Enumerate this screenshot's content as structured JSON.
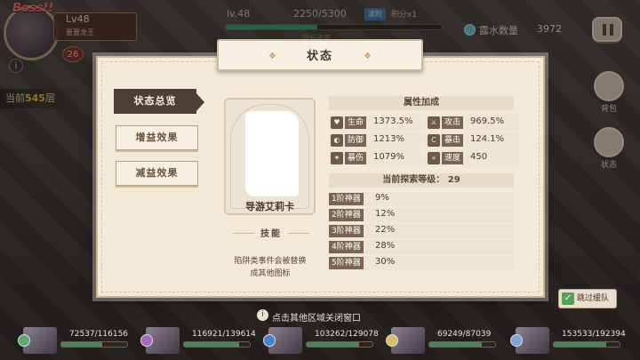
{
  "boss": {
    "tag": "Boss!!",
    "level": "Lv48",
    "name": "噩噩龙王",
    "count": "26"
  },
  "floor": {
    "prefix": "当前",
    "num": "545",
    "suffix": "层"
  },
  "hud": {
    "level": "lv.48",
    "xp": "2250/5300",
    "mode_badge": "波险",
    "mode_text": "积分x1",
    "progress_caption": "开拓进度",
    "xp_fraction": 0.4245,
    "dew_label": "露水数量",
    "dew_value": "3972"
  },
  "side": {
    "bag": "背包",
    "status": "状态"
  },
  "panel": {
    "title": "状态"
  },
  "tabs": [
    {
      "label": "状态总览",
      "active": true
    },
    {
      "label": "增益效果",
      "active": false
    },
    {
      "label": "减益效果",
      "active": false
    }
  ],
  "card": {
    "name": "导游艾莉卡",
    "skill_label": "技能",
    "skill_desc_1": "陷阱类事件会被替换",
    "skill_desc_2": "成其他图标"
  },
  "attributes": {
    "header": "属性加成",
    "items": [
      {
        "icon": "heart-icon",
        "symbol": "♥",
        "name": "生命",
        "value": "1373.5%"
      },
      {
        "icon": "sword-icon",
        "symbol": "⚔",
        "name": "攻击",
        "value": "969.5%"
      },
      {
        "icon": "shield-icon",
        "symbol": "◐",
        "name": "防御",
        "value": "1213%"
      },
      {
        "icon": "crit-icon",
        "symbol": "C",
        "name": "暴击",
        "value": "124.1%"
      },
      {
        "icon": "burst-icon",
        "symbol": "✦",
        "name": "暴伤",
        "value": "1079%"
      },
      {
        "icon": "speed-icon",
        "symbol": "»",
        "name": "速度",
        "value": "450"
      }
    ]
  },
  "gear": {
    "header_label": "当前探索等级：",
    "header_value": "29",
    "rows": [
      {
        "name": "1阶神器",
        "value": "9%"
      },
      {
        "name": "2阶神器",
        "value": "12%"
      },
      {
        "name": "3阶神器",
        "value": "22%"
      },
      {
        "name": "4阶神器",
        "value": "28%"
      },
      {
        "name": "5阶神器",
        "value": "30%"
      }
    ]
  },
  "hint": {
    "text": "点击其他区域关闭窗口"
  },
  "skip": {
    "label": "跳过缓队"
  },
  "party": [
    {
      "hp": "72537/116156",
      "color": "#56b06a",
      "fraction": 0.6245
    },
    {
      "hp": "116921/139614",
      "color": "#a06ac0",
      "fraction": 0.8375
    },
    {
      "hp": "103262/129078",
      "color": "#4f7fc4",
      "fraction": 0.8
    },
    {
      "hp": "69249/87039",
      "color": "#d6c25a",
      "fraction": 0.7956
    },
    {
      "hp": "153533/192394",
      "color": "#7fa4d4",
      "fraction": 0.798
    }
  ]
}
